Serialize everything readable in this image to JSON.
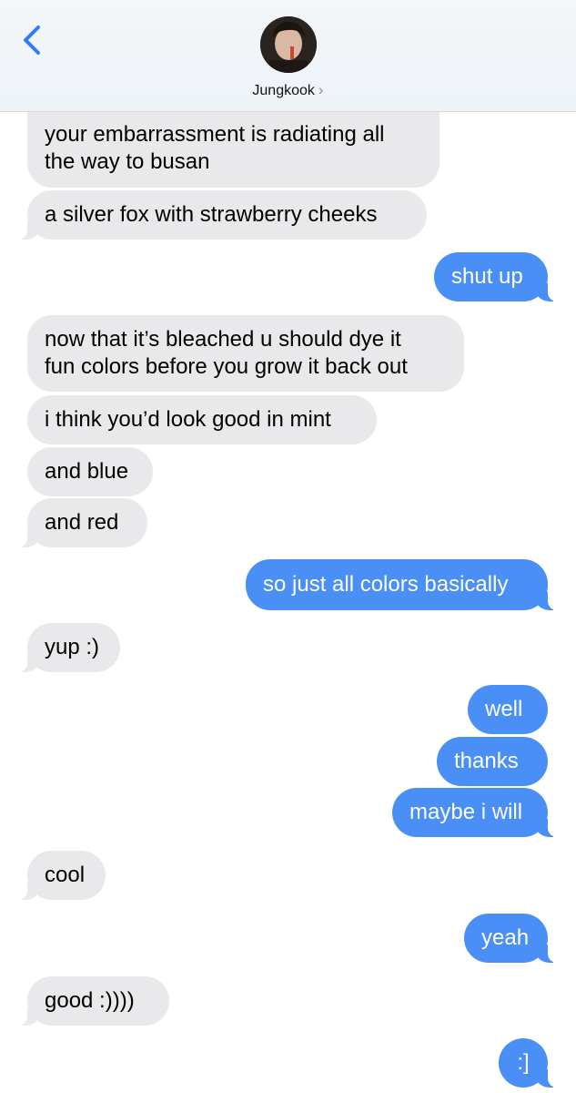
{
  "header": {
    "contact_name": "Jungkook",
    "chevron": "›"
  },
  "messages": [
    {
      "from": "them",
      "text_lines": [
        "your embarrassment is radiating all",
        "the way to busan"
      ]
    },
    {
      "from": "them",
      "text": "a silver fox with strawberry cheeks"
    },
    {
      "from": "me",
      "text": "shut up"
    },
    {
      "from": "them",
      "text_lines": [
        "now that it’s bleached u should dye it",
        "fun colors before you grow it back out"
      ]
    },
    {
      "from": "them",
      "text": "i think you’d look good in mint"
    },
    {
      "from": "them",
      "text": "and blue"
    },
    {
      "from": "them",
      "text": "and red"
    },
    {
      "from": "me",
      "text": "so just all colors basically"
    },
    {
      "from": "them",
      "text": "yup :)"
    },
    {
      "from": "me",
      "text": "well"
    },
    {
      "from": "me",
      "text": "thanks"
    },
    {
      "from": "me",
      "text": "maybe i will"
    },
    {
      "from": "them",
      "text": "cool"
    },
    {
      "from": "me",
      "text": "yeah"
    },
    {
      "from": "them",
      "text": "good :))))"
    },
    {
      "from": "me",
      "text": ":]"
    }
  ],
  "colors": {
    "sent_bubble": "#4a8ff5",
    "received_bubble": "#e9e9eb",
    "accent": "#2f7cf6"
  }
}
